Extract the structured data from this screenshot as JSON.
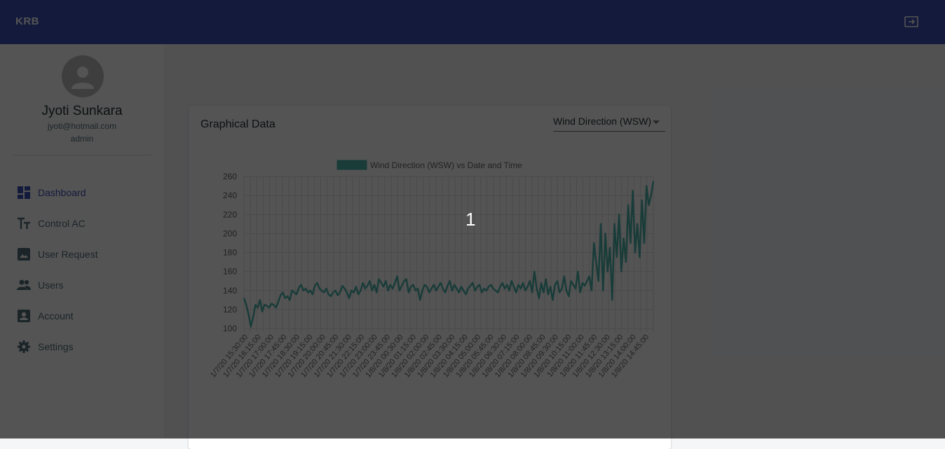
{
  "app": {
    "brand": "KRB"
  },
  "user": {
    "name": "Jyoti Sunkara",
    "email": "jyoti@hotmail.com",
    "role": "admin"
  },
  "nav": [
    {
      "label": "Dashboard",
      "icon": "dashboard-icon",
      "active": true
    },
    {
      "label": "Control AC",
      "icon": "text-fields-icon",
      "active": false
    },
    {
      "label": "User Request",
      "icon": "image-icon",
      "active": false
    },
    {
      "label": "Users",
      "icon": "people-icon",
      "active": false
    },
    {
      "label": "Account",
      "icon": "account-box-icon",
      "active": false
    },
    {
      "label": "Settings",
      "icon": "settings-icon",
      "active": false
    }
  ],
  "card": {
    "title": "Graphical Data",
    "select_value": "Wind Direction (WSW)"
  },
  "overlay": {
    "marker": "1"
  },
  "colors": {
    "primary": "#3f51b5",
    "series": "#4db6ac",
    "text_secondary": "#546e7a"
  },
  "chart_data": {
    "type": "line",
    "legend": "Wind Direction (WSW) vs Date and Time",
    "ylim": [
      100,
      260
    ],
    "yticks": [
      100,
      120,
      140,
      160,
      180,
      200,
      220,
      240,
      260
    ],
    "grid": true,
    "legend_position": "top",
    "x_tick_labels": [
      "1/7/20 15:30:00",
      "1/7/20 16:15:00",
      "1/7/20 17:00:00",
      "1/7/20 17:45:00",
      "1/7/20 18:30:00",
      "1/7/20 19:15:00",
      "1/7/20 20:00:00",
      "1/7/20 20:45:00",
      "1/7/20 21:30:00",
      "1/7/20 22:15:00",
      "1/7/20 23:00:00",
      "1/7/20 23:45:00",
      "1/8/20 00:30:00",
      "1/8/20 01:15:00",
      "1/8/20 02:00:00",
      "1/8/20 02:45:00",
      "1/8/20 03:30:00",
      "1/8/20 04:15:00",
      "1/8/20 05:00:00",
      "1/8/20 05:45:00",
      "1/8/20 06:30:00",
      "1/8/20 07:15:00",
      "1/8/20 08:00:00",
      "1/8/20 08:45:00",
      "1/8/20 09:30:00",
      "1/8/20 10:15:00",
      "1/8/20 11:00:00",
      "1/8/20 11:45:00",
      "1/8/20 12:30:00",
      "1/8/20 13:15:00",
      "1/8/20 14:00:00",
      "1/8/20 14:45:00"
    ],
    "values": [
      132,
      125,
      115,
      102,
      112,
      125,
      122,
      130,
      118,
      125,
      124,
      122,
      126,
      125,
      122,
      128,
      135,
      138,
      132,
      134,
      130,
      140,
      138,
      136,
      143,
      146,
      140,
      142,
      138,
      140,
      136,
      145,
      148,
      142,
      140,
      138,
      142,
      136,
      134,
      138,
      140,
      135,
      138,
      145,
      142,
      138,
      132,
      140,
      138,
      144,
      136,
      140,
      148,
      142,
      145,
      150,
      140,
      146,
      138,
      152,
      148,
      144,
      150,
      140,
      146,
      142,
      148,
      155,
      140,
      145,
      150,
      152,
      138,
      144,
      146,
      140,
      142,
      130,
      140,
      146,
      144,
      138,
      142,
      146,
      140,
      144,
      148,
      142,
      138,
      145,
      150,
      140,
      146,
      142,
      138,
      144,
      140,
      136,
      142,
      145,
      148,
      140,
      144,
      146,
      138,
      142,
      140,
      144,
      146,
      142,
      140,
      138,
      144,
      148,
      142,
      146,
      140,
      150,
      144,
      138,
      146,
      142,
      148,
      140,
      144,
      150,
      138,
      160,
      142,
      132,
      148,
      138,
      152,
      136,
      144,
      130,
      146,
      150,
      138,
      142,
      155,
      140,
      134,
      150,
      146,
      142,
      160,
      138,
      148,
      145,
      150,
      155,
      140,
      190,
      170,
      150,
      210,
      140,
      200,
      160,
      185,
      130,
      210,
      175,
      220,
      160,
      195,
      170,
      230,
      190,
      245,
      180,
      210,
      175,
      235,
      190,
      250,
      230,
      240,
      255
    ]
  }
}
